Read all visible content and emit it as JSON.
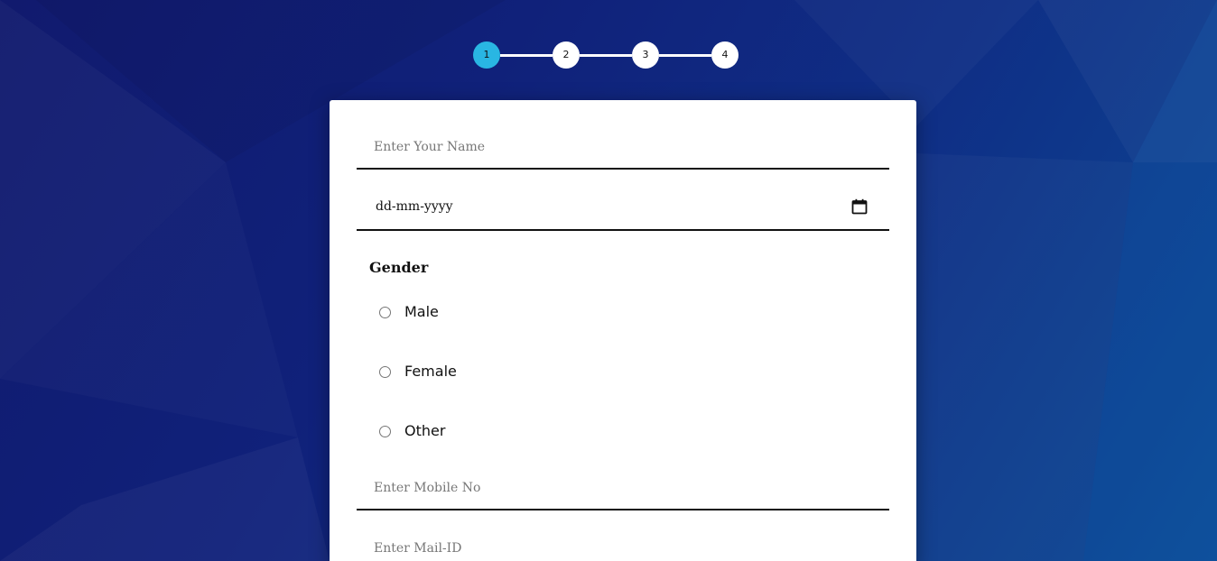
{
  "stepper": {
    "steps": [
      "1",
      "2",
      "3",
      "4"
    ],
    "active_step": 1
  },
  "form": {
    "name": {
      "placeholder": "Enter Your Name",
      "value": ""
    },
    "dob": {
      "value": "dd-mm-yyyy",
      "icon": "calendar-icon"
    },
    "gender": {
      "title": "Gender",
      "options": [
        "Male",
        "Female",
        "Other"
      ]
    },
    "mobile": {
      "placeholder": "Enter Mobile No",
      "value": ""
    },
    "mail": {
      "placeholder": "Enter Mail-ID",
      "value": ""
    }
  },
  "colors": {
    "background_start": "#111a6e",
    "background_end": "#0b4a95",
    "step_active": "#29b6e3",
    "step_inactive": "#ffffff",
    "card": "#ffffff"
  }
}
